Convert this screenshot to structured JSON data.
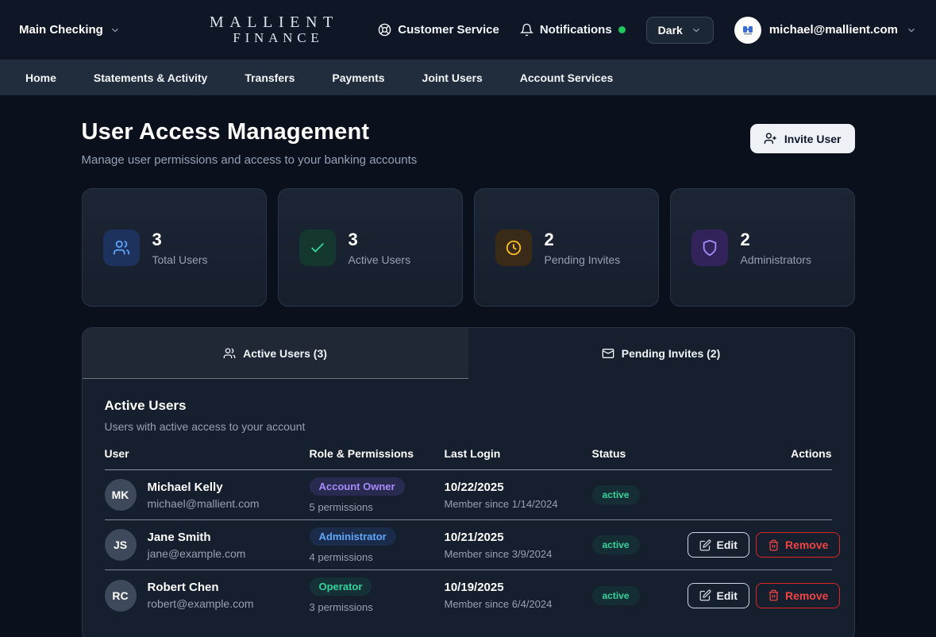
{
  "header": {
    "account_selector": "Main Checking",
    "logo_line1": "MALLIENT",
    "logo_line2": "FINANCE",
    "customer_service_label": "Customer Service",
    "notifications_label": "Notifications",
    "theme_value": "Dark",
    "user_email": "michael@mallient.com"
  },
  "nav": {
    "items": [
      {
        "label": "Home"
      },
      {
        "label": "Statements & Activity"
      },
      {
        "label": "Transfers"
      },
      {
        "label": "Payments"
      },
      {
        "label": "Joint Users"
      },
      {
        "label": "Account Services"
      }
    ]
  },
  "page": {
    "title": "User Access Management",
    "subtitle": "Manage user permissions and access to your banking accounts",
    "invite_button_label": "Invite User"
  },
  "stats": [
    {
      "value": "3",
      "label": "Total Users",
      "icon": "users-icon",
      "accent": "#60a5fa"
    },
    {
      "value": "3",
      "label": "Active Users",
      "icon": "check-icon",
      "accent": "#34d399"
    },
    {
      "value": "2",
      "label": "Pending Invites",
      "icon": "clock-icon",
      "accent": "#fbbf24"
    },
    {
      "value": "2",
      "label": "Administrators",
      "icon": "shield-icon",
      "accent": "#a78bfa"
    }
  ],
  "tabs": [
    {
      "label": "Active Users (3)",
      "icon": "users-icon",
      "active": true
    },
    {
      "label": "Pending Invites (2)",
      "icon": "mail-icon",
      "active": false
    }
  ],
  "table": {
    "heading": "Active Users",
    "subheading": "Users with active access to your account",
    "columns": [
      "User",
      "Role & Permissions",
      "Last Login",
      "Status",
      "Actions"
    ],
    "edit_label": "Edit",
    "remove_label": "Remove",
    "rows": [
      {
        "initials": "MK",
        "name": "Michael Kelly",
        "email": "michael@mallient.com",
        "role": "Account Owner",
        "role_color": "#a78bfa",
        "permissions": "5 permissions",
        "last_login": "10/22/2025",
        "member_since": "Member since 1/14/2024",
        "status": "active",
        "has_actions": false
      },
      {
        "initials": "JS",
        "name": "Jane Smith",
        "email": "jane@example.com",
        "role": "Administrator",
        "role_color": "#60a5fa",
        "permissions": "4 permissions",
        "last_login": "10/21/2025",
        "member_since": "Member since 3/9/2024",
        "status": "active",
        "has_actions": true
      },
      {
        "initials": "RC",
        "name": "Robert Chen",
        "email": "robert@example.com",
        "role": "Operator",
        "role_color": "#34d399",
        "permissions": "3 permissions",
        "last_login": "10/19/2025",
        "member_since": "Member since 6/4/2024",
        "status": "active",
        "has_actions": true
      }
    ]
  },
  "colors": {
    "page_bg": "#0a111d",
    "header_bg": "#0f1726",
    "nav_bg": "#212c3c",
    "panel_bg": "#161f2d",
    "panel_border": "#2a3648",
    "accent_blue": "#60a5fa",
    "accent_green": "#34d399",
    "accent_amber": "#fbbf24",
    "accent_purple": "#a78bfa",
    "danger_red": "#ef4444",
    "notification_dot": "#22c55e",
    "muted_text": "#96a1b3"
  }
}
